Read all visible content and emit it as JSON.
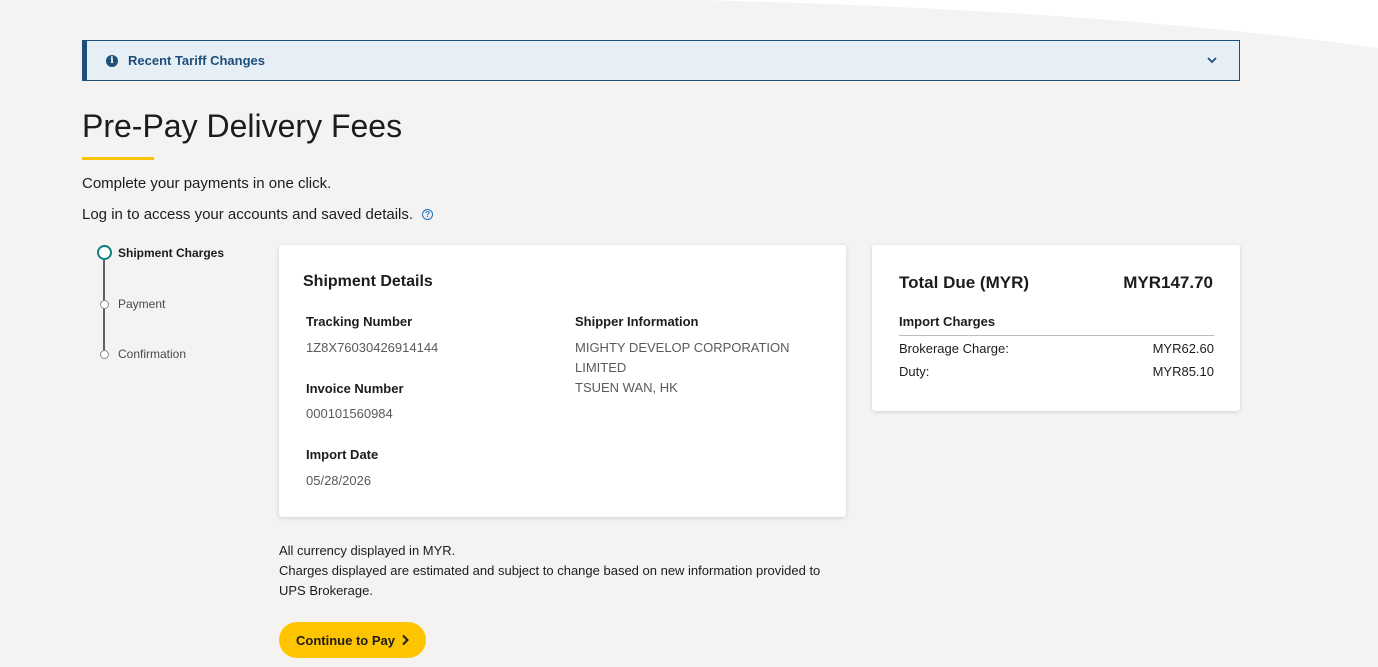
{
  "banner": {
    "title": "Recent Tariff Changes",
    "icon": "info-icon",
    "toggle_icon": "chevron-down-icon",
    "color": "#1f4e79"
  },
  "page": {
    "title": "Pre-Pay Delivery Fees",
    "subtitle": "Complete your payments in one click.",
    "login_text": "Log in to access your accounts and saved details.",
    "accent_color": "#ffc400"
  },
  "stepper": {
    "steps": [
      {
        "label": "Shipment Charges",
        "state": "active"
      },
      {
        "label": "Payment",
        "state": "pending"
      },
      {
        "label": "Confirmation",
        "state": "pending"
      }
    ]
  },
  "shipment": {
    "title": "Shipment Details",
    "tracking_label": "Tracking Number",
    "tracking_value": "1Z8X76030426914144",
    "invoice_label": "Invoice Number",
    "invoice_value": "000101560984",
    "import_date_label": "Import Date",
    "import_date_value": "05/28/2026",
    "shipper_label": "Shipper Information",
    "shipper_line1": "MIGHTY DEVELOP CORPORATION",
    "shipper_line2": "LIMITED",
    "shipper_line3": "TSUEN WAN, HK"
  },
  "total": {
    "label": "Total Due (MYR)",
    "amount": "MYR147.70",
    "section_label": "Import Charges",
    "charges": [
      {
        "label": "Brokerage Charge:",
        "amount": "MYR62.60"
      },
      {
        "label": "Duty:",
        "amount": "MYR85.10"
      }
    ]
  },
  "notes": {
    "line1": "All currency displayed in MYR.",
    "line2": "Charges displayed are estimated and subject to change based on new information provided to UPS Brokerage."
  },
  "actions": {
    "continue_label": "Continue to Pay"
  }
}
